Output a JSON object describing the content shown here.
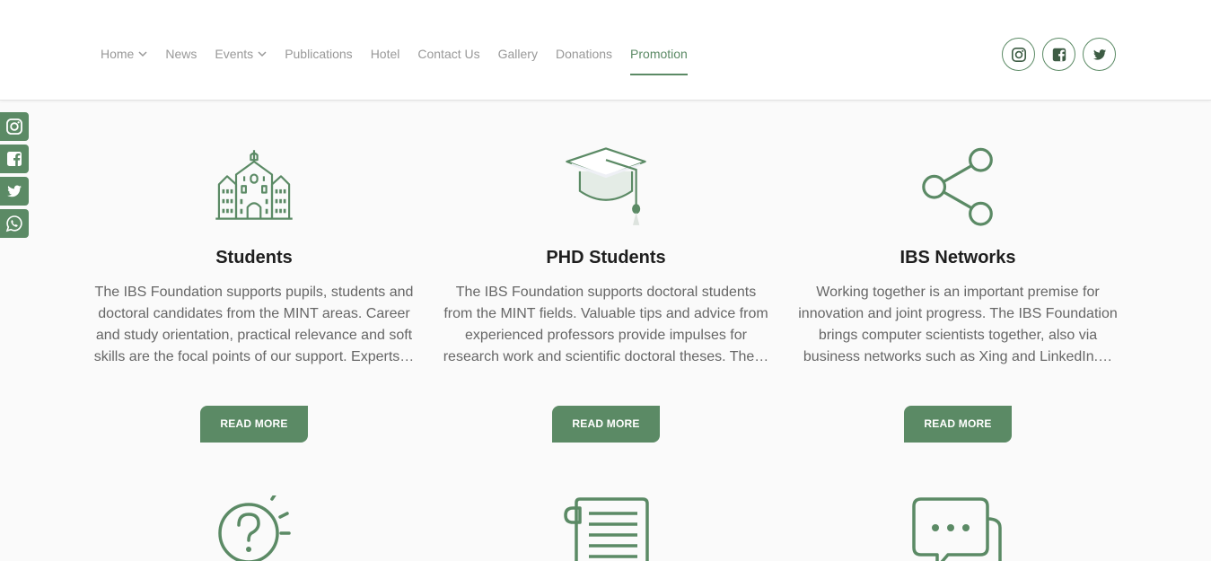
{
  "nav": {
    "items": [
      {
        "label": "Home",
        "dropdown": true
      },
      {
        "label": "News",
        "dropdown": false
      },
      {
        "label": "Events",
        "dropdown": true
      },
      {
        "label": "Publications",
        "dropdown": false
      },
      {
        "label": "Hotel",
        "dropdown": false
      },
      {
        "label": "Contact Us",
        "dropdown": false
      },
      {
        "label": "Gallery",
        "dropdown": false
      },
      {
        "label": "Donations",
        "dropdown": false
      },
      {
        "label": "Promotion",
        "dropdown": false,
        "active": true
      }
    ]
  },
  "social": [
    "instagram-icon",
    "facebook-icon",
    "twitter-icon"
  ],
  "side_share": [
    "instagram-icon",
    "facebook-icon",
    "twitter-icon",
    "whatsapp-icon"
  ],
  "cards": [
    {
      "icon": "university-building-icon",
      "title": "Students",
      "text": "The IBS Foundation supports pupils, students and doctoral candidates from the MINT areas. Career and study orientation, practical relevance and soft skills are the focal points of our support. Experts…",
      "button": "READ MORE"
    },
    {
      "icon": "graduation-cap-icon",
      "title": "PHD Students",
      "text": "The IBS Foundation supports doctoral students from the MINT fields. Valuable tips and advice from experienced professors provide impulses for research work and scientific doctoral theses. The…",
      "button": "READ MORE"
    },
    {
      "icon": "share-network-icon",
      "title": "IBS Networks",
      "text": "Working together is an important premise for innovation and joint progress. The IBS Foundation brings computer scientists together, also via business networks such as Xing and LinkedIn.…",
      "button": "READ MORE"
    }
  ],
  "bottom_icons": [
    "question-idea-icon",
    "document-scroll-icon",
    "chat-bubble-icon"
  ],
  "colors": {
    "accent": "#5b8a65",
    "background": "#fafafa",
    "header": "#ffffff"
  }
}
